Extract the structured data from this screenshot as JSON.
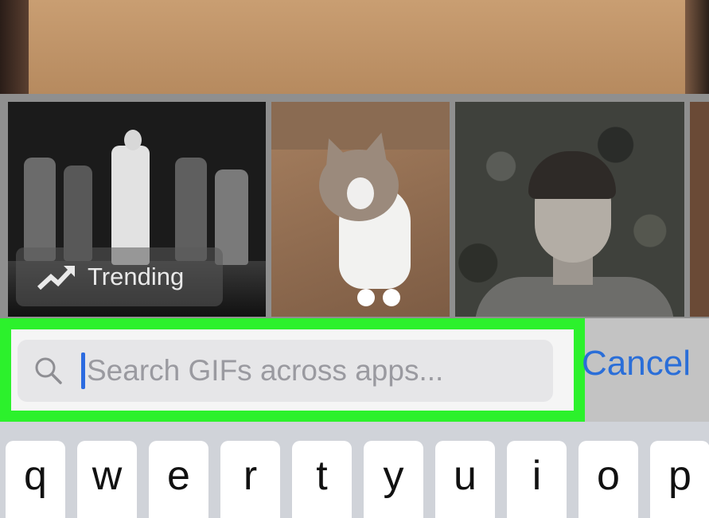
{
  "gif_strip": {
    "trending_label": "Trending"
  },
  "search": {
    "placeholder": "Search GIFs across apps...",
    "value": "",
    "cancel_label": "Cancel"
  },
  "keyboard": {
    "keys": [
      "q",
      "w",
      "e",
      "r",
      "t",
      "y",
      "u",
      "i",
      "o",
      "p"
    ]
  },
  "colors": {
    "highlight": "#2cf12c",
    "accent": "#2a6ed8",
    "caret": "#2c6be0"
  },
  "icons": {
    "search": "search-icon",
    "trending": "trending-up-icon"
  }
}
